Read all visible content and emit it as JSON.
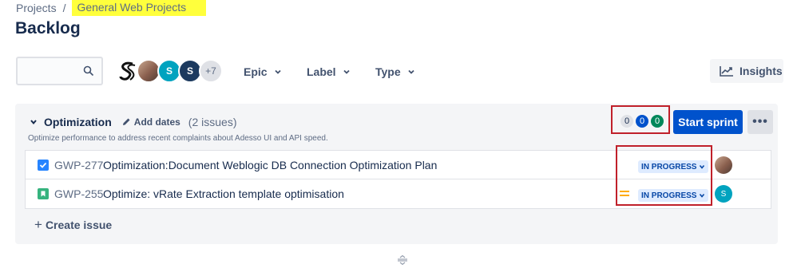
{
  "breadcrumb": {
    "root": "Projects",
    "separator": "/",
    "current": "General Web Projects"
  },
  "page": {
    "title": "Backlog"
  },
  "toolbar": {
    "search_placeholder": "",
    "avatars": [
      {
        "kind": "logo",
        "initial": ""
      },
      {
        "kind": "photo",
        "initial": ""
      },
      {
        "kind": "teal",
        "initial": "S"
      },
      {
        "kind": "navy",
        "initial": "S"
      }
    ],
    "more_avatars": "+7",
    "filters": [
      "Epic",
      "Label",
      "Type"
    ],
    "insights_label": "Insights"
  },
  "sprint": {
    "name": "Optimization",
    "add_dates_label": "Add dates",
    "issue_count": "(2 issues)",
    "description": "Optimize performance to address recent complaints about Adesso UI and API speed.",
    "counts": {
      "todo": "0",
      "in_progress": "0",
      "done": "0"
    },
    "start_label": "Start sprint",
    "more_label": "•••",
    "issues": [
      {
        "type": "task",
        "key": "GWP-277",
        "summary": "Optimization:Document Weblogic DB Connection Optimization Plan",
        "status": "IN PROGRESS",
        "priority": "",
        "assignee": ""
      },
      {
        "type": "story",
        "key": "GWP-255",
        "summary": "Optimize: vRate Extraction template optimisation",
        "status": "IN PROGRESS",
        "priority": "medium",
        "assignee": "S"
      }
    ],
    "create_issue_label": "Create issue"
  },
  "colors": {
    "primary": "#0052cc",
    "highlight": "#ffff3c",
    "annotation_red": "#c0202a",
    "status_bg": "#deebff",
    "done_green": "#00875a"
  }
}
